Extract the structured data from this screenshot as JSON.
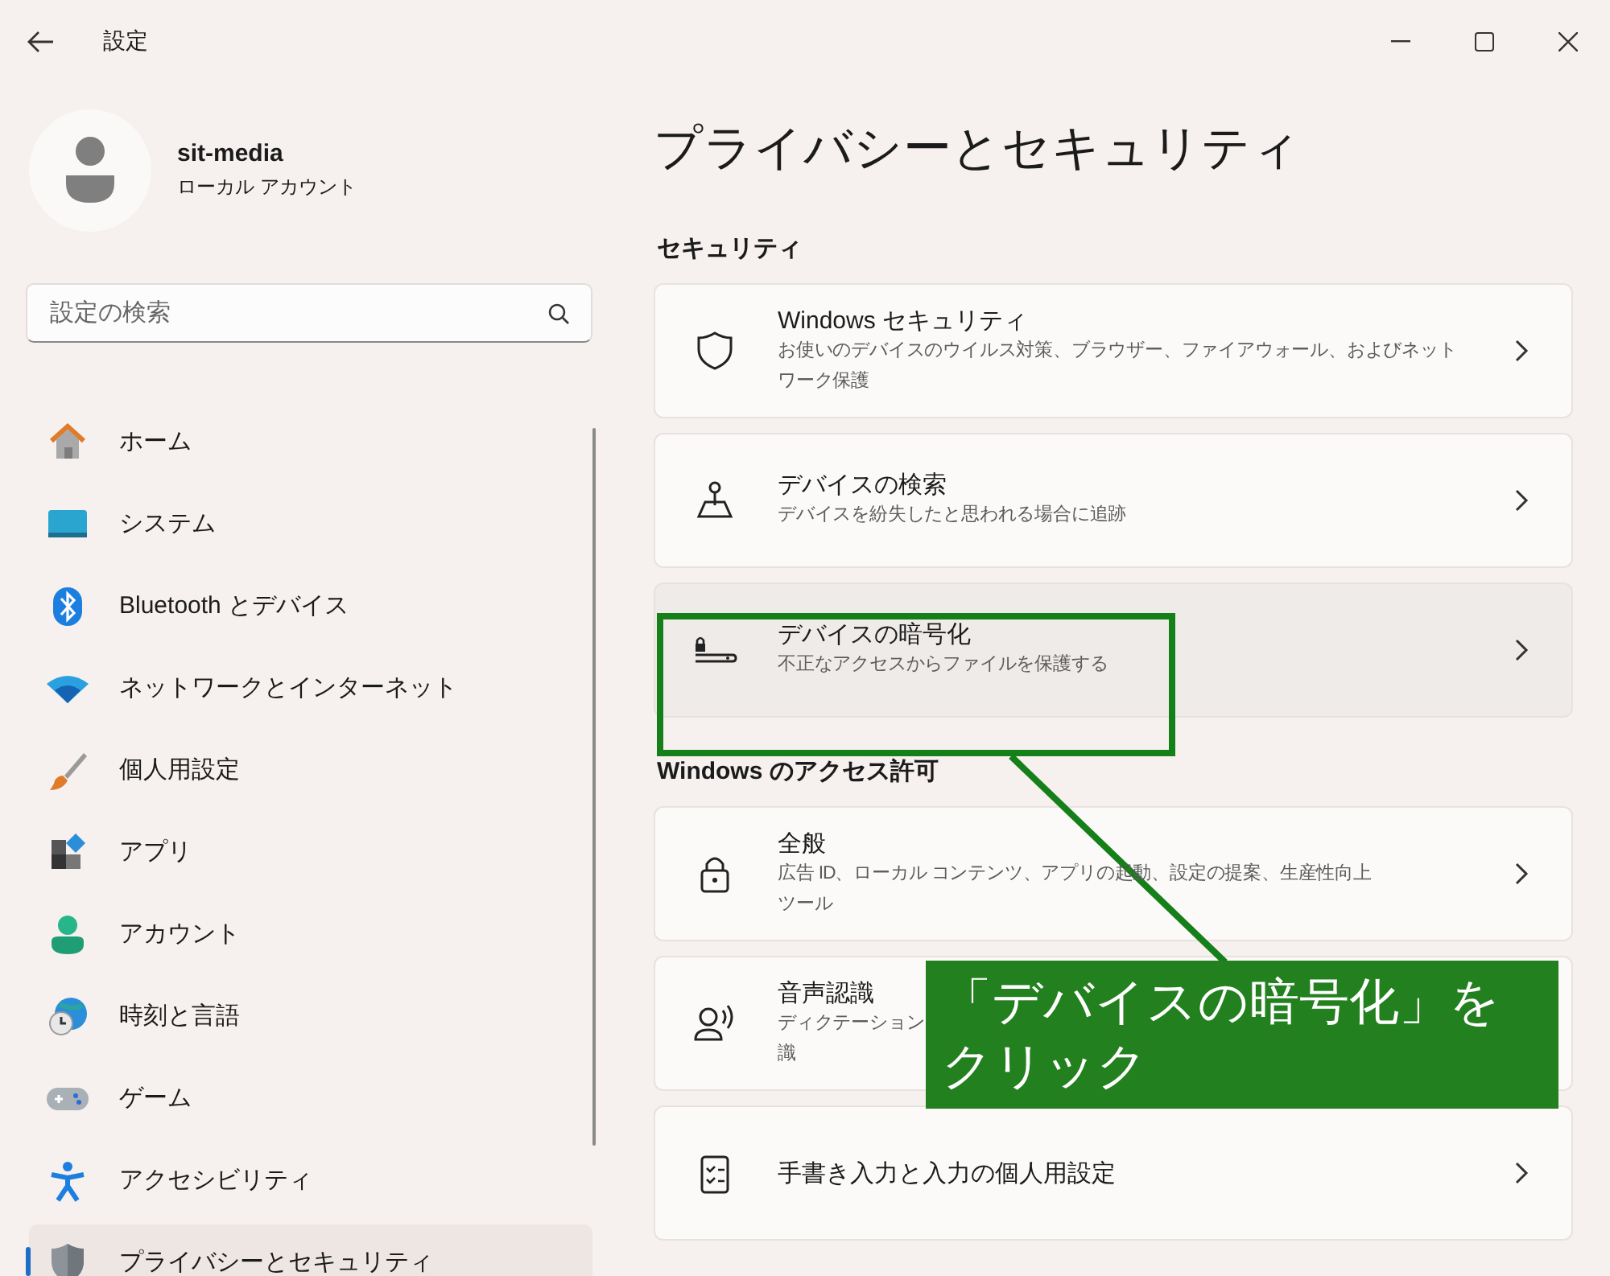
{
  "window": {
    "title": "設定"
  },
  "account": {
    "name": "sit-media",
    "type": "ローカル アカウント"
  },
  "search": {
    "placeholder": "設定の検索"
  },
  "nav": [
    {
      "label": "ホーム",
      "selected": false
    },
    {
      "label": "システム",
      "selected": false
    },
    {
      "label": "Bluetooth とデバイス",
      "selected": false
    },
    {
      "label": "ネットワークとインターネット",
      "selected": false
    },
    {
      "label": "個人用設定",
      "selected": false
    },
    {
      "label": "アプリ",
      "selected": false
    },
    {
      "label": "アカウント",
      "selected": false
    },
    {
      "label": "時刻と言語",
      "selected": false
    },
    {
      "label": "ゲーム",
      "selected": false
    },
    {
      "label": "アクセシビリティ",
      "selected": false
    },
    {
      "label": "プライバシーとセキュリティ",
      "selected": true
    }
  ],
  "page_title": "プライバシーとセキュリティ",
  "sections": [
    {
      "heading": "セキュリティ",
      "items": [
        {
          "title": "Windows セキュリティ",
          "description": [
            "お使いのデバイスのウイルス対策、ブラウザー、ファイアウォール、およびネット",
            "ワーク保護"
          ],
          "hovered": false,
          "chevron": true
        },
        {
          "title": "デバイスの検索",
          "description": [
            "デバイスを紛失したと思われる場合に追跡"
          ],
          "hovered": false,
          "chevron": true
        },
        {
          "title": "デバイスの暗号化",
          "description": [
            "不正なアクセスからファイルを保護する"
          ],
          "hovered": true,
          "chevron": true
        }
      ]
    },
    {
      "heading": "Windows のアクセス許可",
      "items": [
        {
          "title": "全般",
          "description": [
            "広告 ID、ローカル コンテンツ、アプリの起動、設定の提案、生産性向上",
            "ツール"
          ],
          "hovered": false,
          "chevron": true
        },
        {
          "title": "音声認識",
          "description": [
            "ディクテーション",
            "識"
          ],
          "hovered": false,
          "chevron": false
        },
        {
          "title": "手書き入力と入力の個人用設定",
          "hovered": false,
          "chevron": true
        }
      ]
    }
  ],
  "callout": {
    "text": "「デバイスの暗号化」をクリック"
  }
}
